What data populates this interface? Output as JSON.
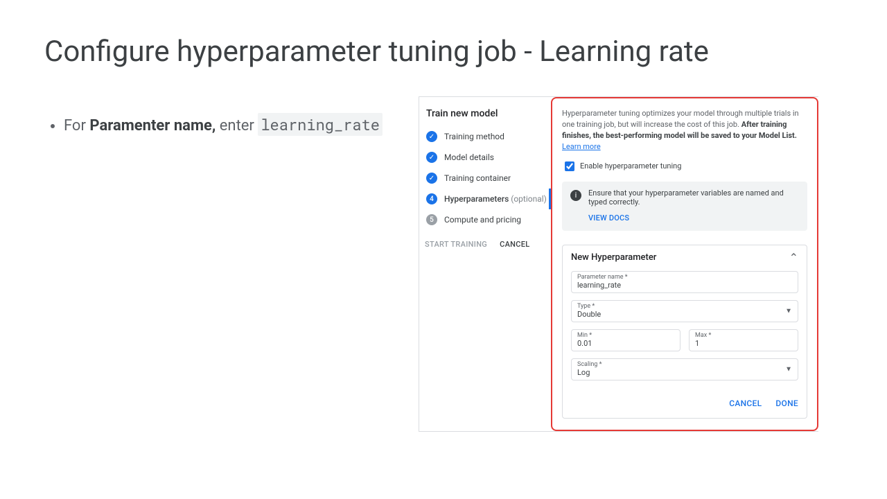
{
  "title": "Configure hyperparameter tuning job - Learning rate",
  "instructions": {
    "prefix": "For ",
    "bold": "Paramenter name,",
    "suffix": " enter ",
    "code": "learning_rate"
  },
  "stepper": {
    "title": "Train new model",
    "steps": [
      {
        "label": "Training method"
      },
      {
        "label": "Model details"
      },
      {
        "label": "Training container"
      },
      {
        "label": "Hyperparameters",
        "optional": "(optional)",
        "num": "4"
      },
      {
        "label": "Compute and pricing",
        "num": "5"
      }
    ],
    "start": "START TRAINING",
    "cancel": "CANCEL"
  },
  "panel": {
    "desc_start": "Hyperparameter tuning optimizes your model through multiple trials in one training job, but will increase the cost of this job. ",
    "desc_bold": "After training finishes, the best-performing model will be saved to your Model List.",
    "learn_more": "Learn more",
    "checkbox_label": "Enable hyperparameter tuning",
    "info_text": "Ensure that your hyperparameter variables are named and typed correctly.",
    "view_docs": "VIEW DOCS",
    "card": {
      "title": "New Hyperparameter",
      "param_label": "Parameter name *",
      "param_value": "learning_rate",
      "type_label": "Type *",
      "type_value": "Double",
      "min_label": "Min *",
      "min_value": "0.01",
      "max_label": "Max *",
      "max_value": "1",
      "scaling_label": "Scaling *",
      "scaling_value": "Log",
      "cancel": "CANCEL",
      "done": "DONE"
    }
  }
}
